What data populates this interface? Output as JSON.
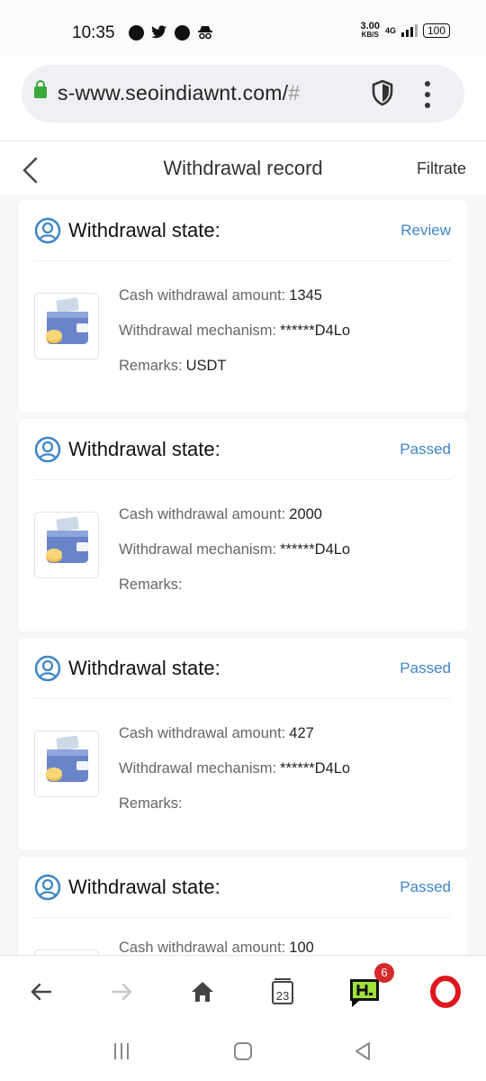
{
  "status_bar": {
    "time": "10:35",
    "speed_value": "3.00",
    "speed_unit": "KB/S",
    "network": "4G",
    "battery": "100"
  },
  "url_bar": {
    "url_main": "s-www.seoindiawnt.com/",
    "url_tail": "#"
  },
  "header": {
    "title": "Withdrawal record",
    "filter_label": "Filtrate"
  },
  "labels": {
    "state": "Withdrawal state:",
    "amount": "Cash withdrawal amount:",
    "mechanism": "Withdrawal mechanism:",
    "remarks": "Remarks:"
  },
  "records": [
    {
      "status": "Review",
      "amount": "1345",
      "mechanism": "******D4Lo",
      "remarks": "USDT"
    },
    {
      "status": "Passed",
      "amount": "2000",
      "mechanism": "******D4Lo",
      "remarks": ""
    },
    {
      "status": "Passed",
      "amount": "427",
      "mechanism": "******D4Lo",
      "remarks": ""
    },
    {
      "status": "Passed",
      "amount": "100",
      "mechanism": "",
      "remarks": ""
    }
  ],
  "bottom_nav": {
    "tabs_count": "23",
    "badge_count": "6"
  },
  "colors": {
    "accent_blue": "#3e86c6",
    "status_green_lock": "#3aa93a",
    "opera_red": "#e0161e"
  }
}
